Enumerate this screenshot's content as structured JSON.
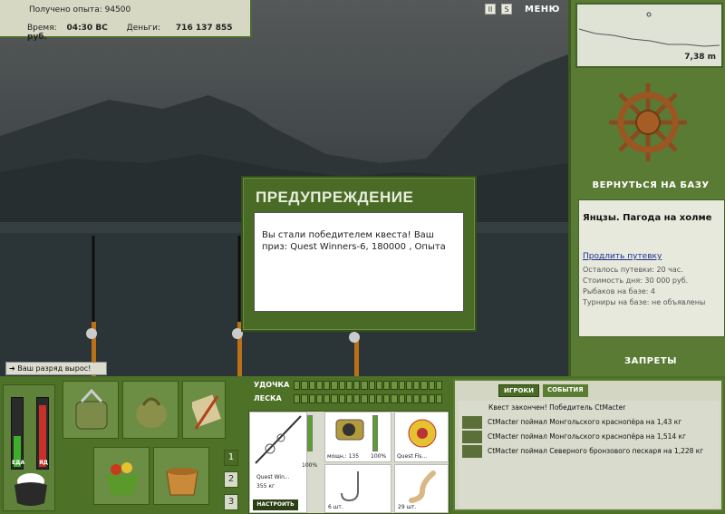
{
  "top_info": {
    "exp_label": "Получено опыта:",
    "exp_value": "94500",
    "time_label": "Время:",
    "time_value": "04:30 ВС",
    "money_label": "Деньги:",
    "money_value": "716 137 855 руб."
  },
  "top_icons": {
    "pause": "II",
    "sound": "S",
    "menu_label": "МЕНЮ"
  },
  "depth": {
    "value": "7,38 m"
  },
  "right_panel": {
    "return_base": "ВЕРНУТЬСЯ НА БАЗУ",
    "location_title": "Янцзы. Пагода на холме",
    "extend_link": "Продлить путевку",
    "remaining": "Осталось путевки: 20 час.",
    "day_cost": "Стоимость дня: 30 000 руб.",
    "fishers": "Рыбаков на базе: 4",
    "tournaments": "Турниры на базе: не объявлены",
    "bans": "ЗАПРЕТЫ"
  },
  "rank_message": "Ваш разряд вырос!",
  "dialog": {
    "title": "ПРЕДУПРЕЖДЕНИЕ",
    "text": "Вы стали победителем квеста! Ваш приз: Quest Winners-6, 180000 , Опыта"
  },
  "meters": {
    "food_label": "ЕДА",
    "poison_label": "ЯД",
    "food_level": 0.45,
    "poison_level": 0.9,
    "food_color": "#3fae2a",
    "poison_color": "#c8312a"
  },
  "side_numbers": [
    "1",
    "2",
    "3"
  ],
  "gear": {
    "rod_label": "УДОЧКА",
    "line_label": "ЛЕСКА",
    "rod_name": "Quest Win...",
    "rod_weight": "355 кг",
    "rod_pct": "100%",
    "reel_power": "мощн.: 135",
    "reel_pct": "100%",
    "line_name": "Quest Fis...",
    "hook_count": "6 шт.",
    "bait_count": "29 шт.",
    "setup_button": "НАСТРОИТЬ"
  },
  "events": {
    "tab_players": "ИГРОКИ",
    "tab_events": "СОБЫТИЯ",
    "items": [
      "Квест закончен! Победитель CtMacter",
      "CtMacter поймал Монгольского краснопёра на 1,43 кг",
      "CtMacter поймал Монгольского краснопёра на 1,514 кг",
      "CtMacter поймал Северного бронзового пескаря на 1,228 кг"
    ]
  }
}
